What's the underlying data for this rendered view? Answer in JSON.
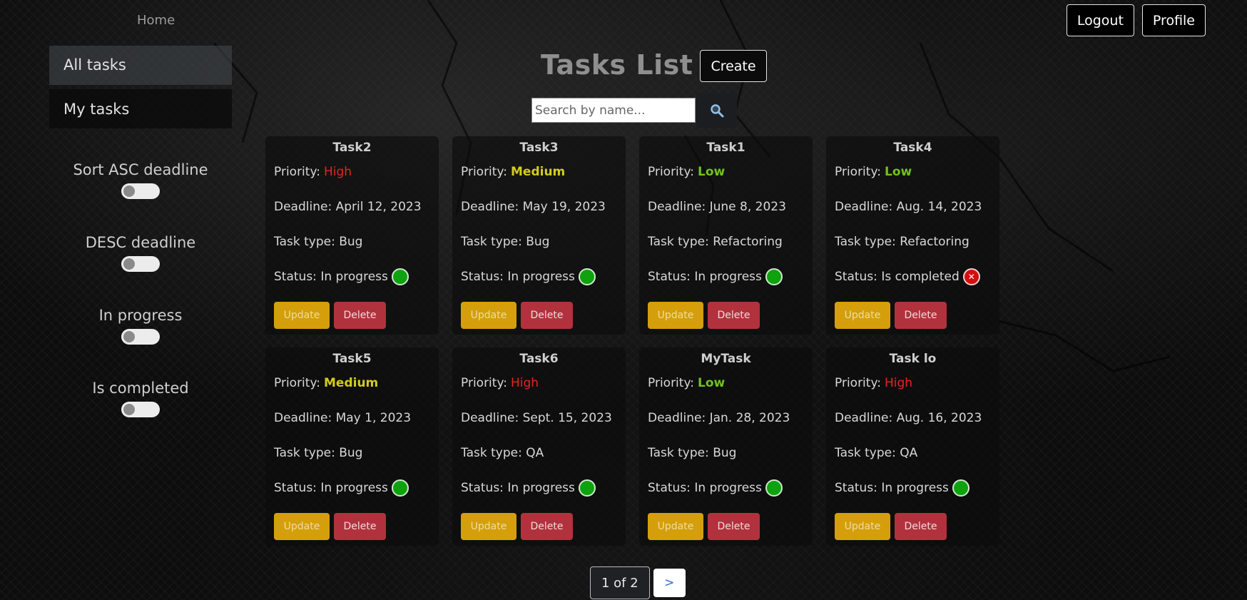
{
  "nav": {
    "home": "Home"
  },
  "topbar": {
    "logout": "Logout",
    "profile": "Profile"
  },
  "sidebar": {
    "items": [
      {
        "label": "All tasks",
        "active": true
      },
      {
        "label": "My tasks",
        "active": false
      }
    ],
    "filters": [
      {
        "label": "Sort ASC deadline",
        "on": false
      },
      {
        "label": "DESC deadline",
        "on": false
      },
      {
        "label": "In progress",
        "on": false
      },
      {
        "label": "Is completed",
        "on": false
      }
    ]
  },
  "header": {
    "title": "Tasks List",
    "create": "Create"
  },
  "search": {
    "placeholder": "Search by name...",
    "value": "",
    "icon": "search-icon"
  },
  "labels": {
    "priority": "Priority:",
    "deadline": "Deadline:",
    "task_type": "Task type:",
    "status": "Status:",
    "update": "Update",
    "delete": "Delete"
  },
  "tasks": [
    {
      "name": "Task2",
      "priority": "High",
      "deadline": "April 12, 2023",
      "type": "Bug",
      "status": "In progress"
    },
    {
      "name": "Task3",
      "priority": "Medium",
      "deadline": "May 19, 2023",
      "type": "Bug",
      "status": "In progress"
    },
    {
      "name": "Task1",
      "priority": "Low",
      "deadline": "June 8, 2023",
      "type": "Refactoring",
      "status": "In progress"
    },
    {
      "name": "Task4",
      "priority": "Low",
      "deadline": "Aug. 14, 2023",
      "type": "Refactoring",
      "status": "Is completed"
    },
    {
      "name": "Task5",
      "priority": "Medium",
      "deadline": "May 1, 2023",
      "type": "Bug",
      "status": "In progress"
    },
    {
      "name": "Task6",
      "priority": "High",
      "deadline": "Sept. 15, 2023",
      "type": "QA",
      "status": "In progress"
    },
    {
      "name": "MyTask",
      "priority": "Low",
      "deadline": "Jan. 28, 2023",
      "type": "Bug",
      "status": "In progress"
    },
    {
      "name": "Task lo",
      "priority": "High",
      "deadline": "Aug. 16, 2023",
      "type": "QA",
      "status": "In progress"
    }
  ],
  "colors": {
    "high": "#e3261f",
    "medium": "#d2cc1e",
    "low": "#72c21e",
    "update_button": "#d49f0b",
    "delete_button": "#b1323d",
    "status_in_progress": "#0fa20f",
    "status_completed": "#d20f0f"
  },
  "pagination": {
    "current": "1 of 2",
    "next": ">"
  }
}
